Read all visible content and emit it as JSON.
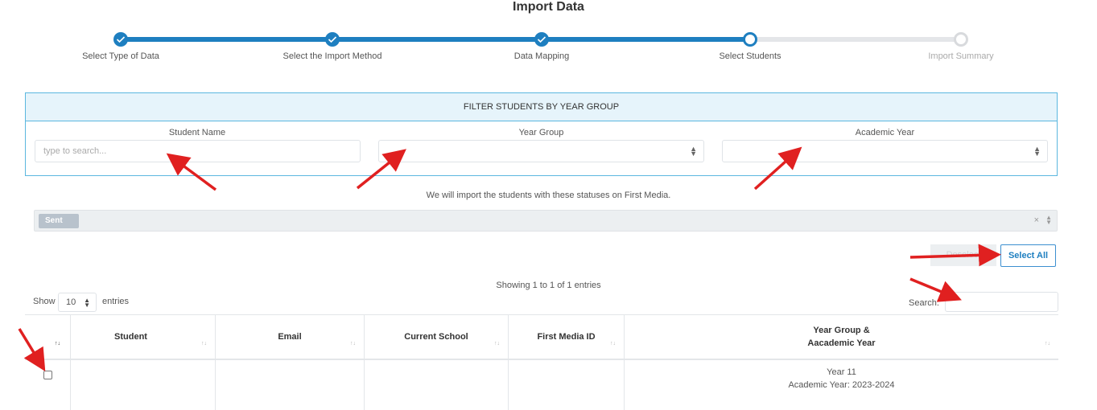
{
  "page": {
    "title": "Import Data"
  },
  "steps": [
    {
      "label": "Select Type of Data",
      "state": "done"
    },
    {
      "label": "Select the Import Method",
      "state": "done"
    },
    {
      "label": "Data Mapping",
      "state": "done"
    },
    {
      "label": "Select Students",
      "state": "current"
    },
    {
      "label": "Import Summary",
      "state": "todo"
    }
  ],
  "colors": {
    "accent": "#1e7fc0",
    "filter_border": "#5bb7df",
    "filter_head_bg": "#e6f4fb",
    "arrow": "#e02020"
  },
  "filter": {
    "heading": "FILTER STUDENTS BY YEAR GROUP",
    "student_name_label": "Student Name",
    "student_name_placeholder": "type to search...",
    "student_name_value": "",
    "year_group_label": "Year Group",
    "year_group_value": "",
    "academic_year_label": "Academic Year",
    "academic_year_value": ""
  },
  "statuses": {
    "message": "We will import the students with these statuses on First Media.",
    "tags": [
      "Sent"
    ],
    "clear_glyph": "×"
  },
  "actions": {
    "deselect_label": "Deselect",
    "select_all_label": "Select All"
  },
  "table_controls": {
    "info": "Showing 1 to 1 of 1 entries",
    "show_label": "Show",
    "page_size": "10",
    "entries_label": "entries",
    "search_label": "Search:",
    "search_value": ""
  },
  "table": {
    "headers": [
      "Student",
      "Email",
      "Current School",
      "First Media ID"
    ],
    "year_header_line1": "Year Group &",
    "year_header_line2": "Aacademic Year",
    "rows": [
      {
        "student": "",
        "email": "",
        "school": "",
        "id": "",
        "year_group": "Year 11",
        "academic_year": "Academic Year: 2023-2024"
      }
    ]
  },
  "icons": [
    "check-icon",
    "sort-icon",
    "select-caret-icon",
    "clear-icon",
    "annotation-arrow"
  ]
}
